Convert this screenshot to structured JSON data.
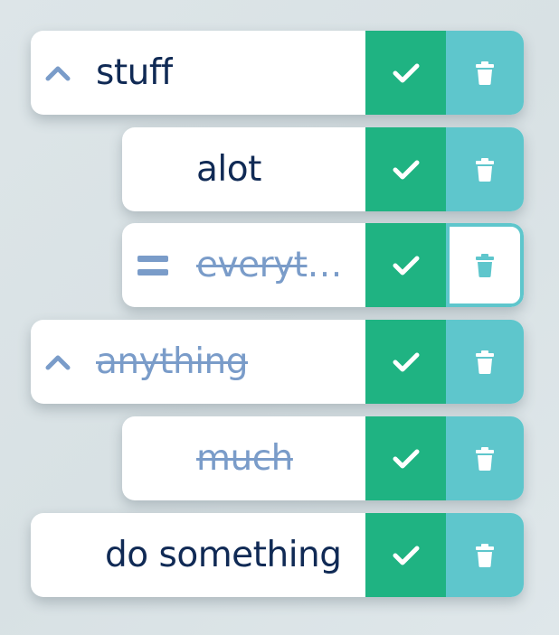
{
  "colors": {
    "check": "#1fb382",
    "delete": "#5ec6cc",
    "text": "#102a55",
    "done_text": "#7a9cc9",
    "icon": "#7a9cc9"
  },
  "items": [
    {
      "label": "stuff",
      "done": false,
      "lead_icon": "chevron-up-icon"
    },
    {
      "label": "alot",
      "done": false,
      "lead_icon": null
    },
    {
      "label": "everyth…",
      "done": true,
      "lead_icon": "drag-handle-icon",
      "delete_outlined": true
    },
    {
      "label": "anything",
      "done": true,
      "lead_icon": "chevron-up-icon"
    },
    {
      "label": "much",
      "done": true,
      "lead_icon": null
    },
    {
      "label": "do something",
      "done": false,
      "lead_icon": null
    }
  ],
  "icons": {
    "check": "check-icon",
    "delete": "trash-icon"
  }
}
